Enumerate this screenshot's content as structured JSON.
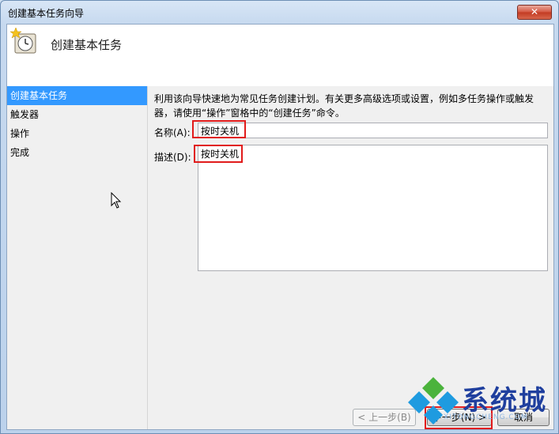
{
  "window": {
    "title": "创建基本任务向导",
    "close_glyph": "✕"
  },
  "header": {
    "title": "创建基本任务"
  },
  "steps": [
    {
      "label": "创建基本任务",
      "active": true
    },
    {
      "label": "触发器",
      "active": false
    },
    {
      "label": "操作",
      "active": false
    },
    {
      "label": "完成",
      "active": false
    }
  ],
  "form": {
    "description_line1": "利用该向导快速地为常见任务创建计划。有关更多高级选项或设置，例如多任务操作或触发",
    "description_line2": "器，请使用“操作”窗格中的“创建任务”命令。",
    "name_label": "名称(A):",
    "name_value": "按时关机",
    "desc_label": "描述(D):",
    "desc_value": "按时关机"
  },
  "buttons": {
    "back": "< 上一步(B)",
    "next": "下一步(N) >",
    "cancel": "取消"
  },
  "watermark": {
    "text": "系统城",
    "url": "XITONGCHENG.COM"
  },
  "colors": {
    "selection": "#3399ff",
    "highlight": "#e11b1b"
  }
}
